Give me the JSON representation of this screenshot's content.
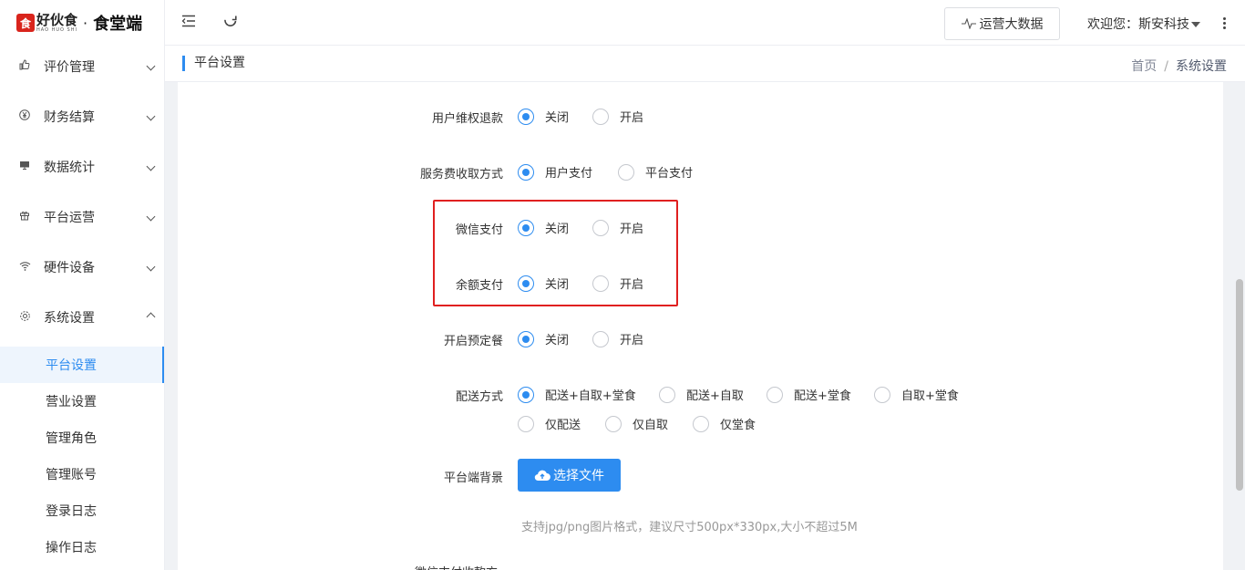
{
  "brand": {
    "logo_char": "食",
    "brand_name": "好伙食",
    "brand_sub": "HAO HUO SHI",
    "separator": "·",
    "app_title": "食堂端"
  },
  "sidebar": {
    "groups": [
      {
        "label": "评价管理",
        "icon": "thumbs-up-icon"
      },
      {
        "label": "财务结算",
        "icon": "yen-icon"
      },
      {
        "label": "数据统计",
        "icon": "monitor-icon"
      },
      {
        "label": "平台运营",
        "icon": "gift-icon"
      },
      {
        "label": "硬件设备",
        "icon": "wifi-icon"
      },
      {
        "label": "系统设置",
        "icon": "gear-icon"
      }
    ],
    "subitems": [
      {
        "label": "平台设置"
      },
      {
        "label": "营业设置"
      },
      {
        "label": "管理角色"
      },
      {
        "label": "管理账号"
      },
      {
        "label": "登录日志"
      },
      {
        "label": "操作日志"
      }
    ]
  },
  "header": {
    "bigdata_label": "运营大数据",
    "welcome": "欢迎您：斯安科技"
  },
  "crumb": {
    "page_title": "平台设置",
    "home": "首页",
    "separator": "/",
    "current": "系统设置"
  },
  "form": {
    "refund": {
      "label": "用户维权退款",
      "opt1": "关闭",
      "opt2": "开启"
    },
    "service_fee": {
      "label": "服务费收取方式",
      "opt1": "用户支付",
      "opt2": "平台支付"
    },
    "wechat_pay": {
      "label": "微信支付",
      "opt1": "关闭",
      "opt2": "开启"
    },
    "balance_pay": {
      "label": "余额支付",
      "opt1": "关闭",
      "opt2": "开启"
    },
    "preorder": {
      "label": "开启预定餐",
      "opt1": "关闭",
      "opt2": "开启"
    },
    "delivery": {
      "label": "配送方式",
      "opt1": "配送+自取+堂食",
      "opt2": "配送+自取",
      "opt3": "配送+堂食",
      "opt4": "自取+堂食",
      "opt5": "仅配送",
      "opt6": "仅自取",
      "opt7": "仅堂食"
    },
    "background": {
      "label": "平台端背景",
      "button": "选择文件",
      "hint": "支持jpg/png图片格式，建议尺寸500px*330px,大小不超过5M"
    },
    "cut_label": "微信支付收款方"
  },
  "colors": {
    "primary": "#2d8cf0",
    "highlight": "#e02020"
  }
}
